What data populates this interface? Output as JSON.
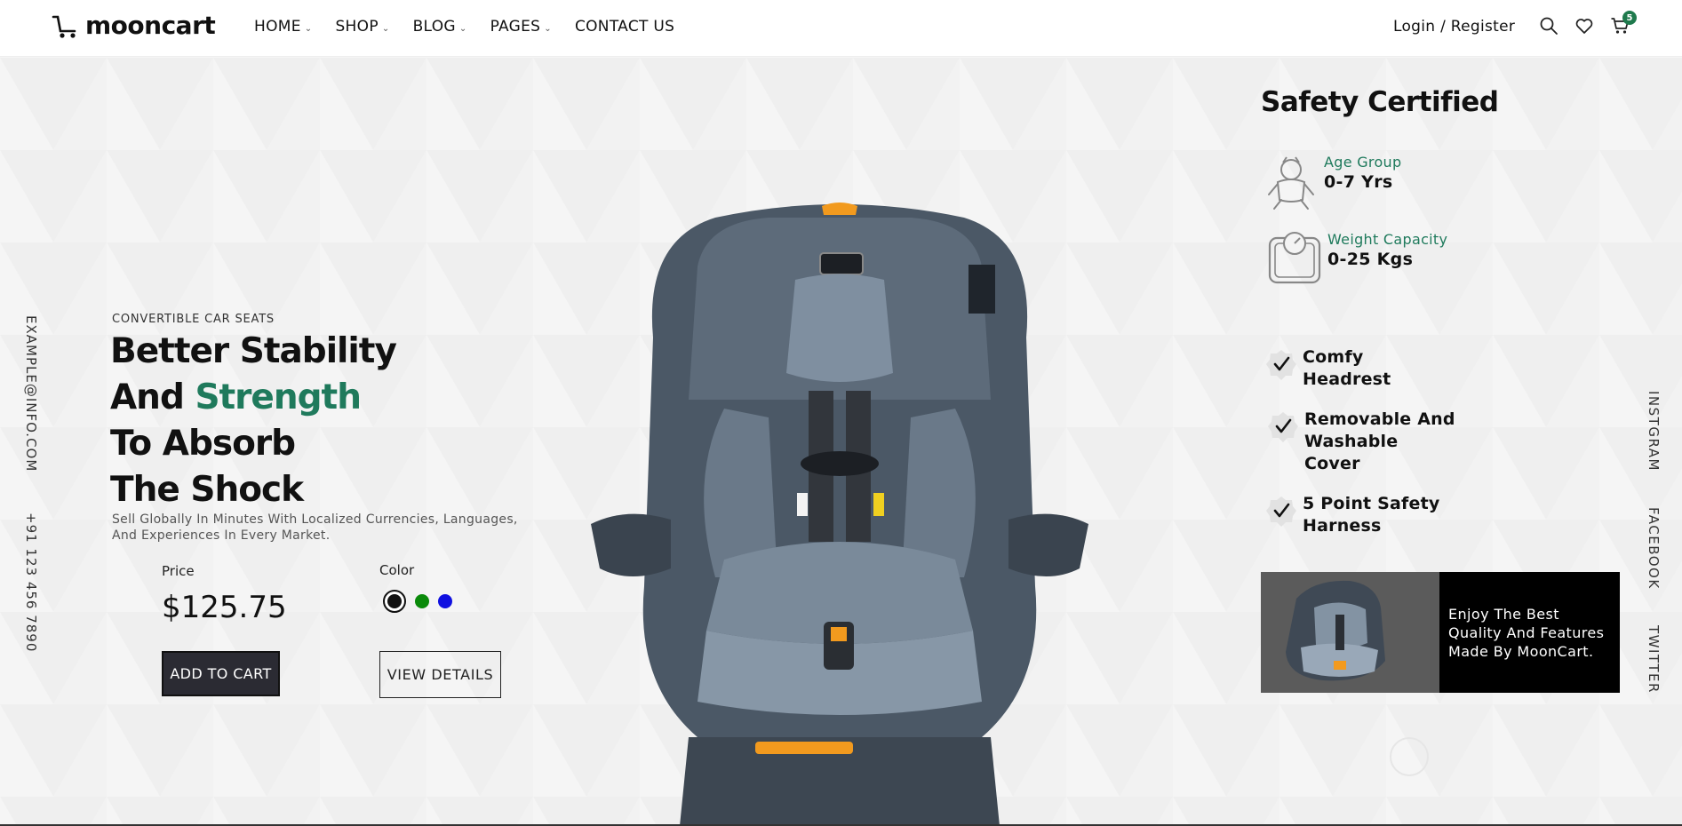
{
  "brand": {
    "name": "mooncart"
  },
  "nav": {
    "items": [
      {
        "label": "HOME",
        "dropdown": true
      },
      {
        "label": "SHOP",
        "dropdown": true
      },
      {
        "label": "BLOG",
        "dropdown": true
      },
      {
        "label": "PAGES",
        "dropdown": true
      },
      {
        "label": "CONTACT US",
        "dropdown": false
      }
    ],
    "login": "Login / Register",
    "cart_count": "5"
  },
  "side": {
    "email": "EXAMPLE@INFO.COM",
    "phone": "+91 123 456 7890",
    "social": [
      "INSTGRAM",
      "FACEBOOK",
      "TWITTER"
    ]
  },
  "hero": {
    "eyebrow": "CONVERTIBLE CAR SEATS",
    "headline_line1": "Better Stability",
    "headline_line2_a": "And ",
    "headline_line2_b": "Strength",
    "headline_line3": "To Absorb",
    "headline_line4": "The Shock",
    "description": "Sell Globally In Minutes With Localized Currencies, Languages, And Experiences In Every Market.",
    "price_label": "Price",
    "price": "$125.75",
    "color_label": "Color",
    "colors": [
      "#111111",
      "#0a8a0a",
      "#1010e0"
    ],
    "add_to_cart": "ADD TO CART",
    "view_details": "VIEW DETAILS"
  },
  "specs": {
    "title": "Safety Certified",
    "age_label": "Age Group",
    "age_value": "0-7 Yrs",
    "weight_label": "Weight Capacity",
    "weight_value": "0-25 Kgs"
  },
  "features": [
    {
      "line1": "Comfy",
      "line2": "Headrest",
      "line3": ""
    },
    {
      "line1": "Removable And",
      "line2": "Washable",
      "line3": "Cover"
    },
    {
      "line1": "5 Point Safety",
      "line2": "Harness",
      "line3": ""
    }
  ],
  "promo": {
    "text": "Enjoy The Best Quality And Features Made By MoonCart."
  },
  "colors": {
    "accent": "#1f7a5c",
    "dark_button": "#2b2b33"
  }
}
